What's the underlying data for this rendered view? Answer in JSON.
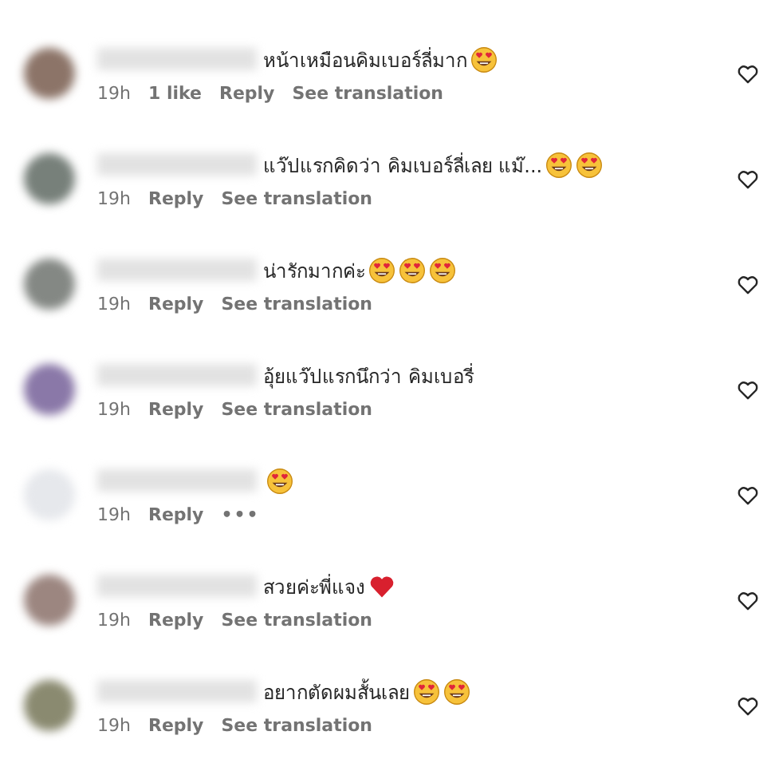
{
  "comments": [
    {
      "avatar": {
        "color": "#8c7468"
      },
      "text": "หน้าเหมือนคิมเบอร์ลี่มาก",
      "emojis": [
        {
          "kind": "heart_eyes"
        }
      ],
      "time": "19h",
      "likes": "1 like",
      "reply": "Reply",
      "translate": "See translation",
      "liked": false
    },
    {
      "avatar": {
        "color": "#77807a"
      },
      "text": "แว๊ปแรกคิดว่า คิมเบอร์ลี่เลย แม๊...",
      "emojis": [
        {
          "kind": "heart_eyes"
        },
        {
          "kind": "heart_eyes"
        }
      ],
      "time": "19h",
      "reply": "Reply",
      "translate": "See translation",
      "liked": false
    },
    {
      "avatar": {
        "color": "#848884"
      },
      "text": "น่ารักมากค่ะ",
      "emojis": [
        {
          "kind": "heart_eyes"
        },
        {
          "kind": "heart_eyes"
        },
        {
          "kind": "heart_eyes"
        }
      ],
      "time": "19h",
      "reply": "Reply",
      "translate": "See translation",
      "liked": false
    },
    {
      "avatar": {
        "color": "#8a78a8"
      },
      "text": "อุ้ยแว๊ปแรกนึกว่า คิมเบอรี่",
      "time": "19h",
      "reply": "Reply",
      "translate": "See translation",
      "liked": false
    },
    {
      "avatar": {
        "color": "#e6e8ec"
      },
      "emojis": [
        {
          "kind": "heart_eyes"
        }
      ],
      "time": "19h",
      "reply": "Reply",
      "more": "•••",
      "liked": false
    },
    {
      "avatar": {
        "color": "#9c8680"
      },
      "text": "สวยค่ะพี่แจง",
      "emojis": [
        {
          "kind": "red_heart"
        }
      ],
      "time": "19h",
      "reply": "Reply",
      "translate": "See translation",
      "liked": false
    },
    {
      "avatar": {
        "color": "#8a8a70"
      },
      "text": "อยากตัดผมสั้นเลย ",
      "emojis": [
        {
          "kind": "heart_eyes"
        },
        {
          "kind": "heart_eyes"
        }
      ],
      "time": "19h",
      "reply": "Reply",
      "translate": "See translation",
      "liked": false
    }
  ]
}
